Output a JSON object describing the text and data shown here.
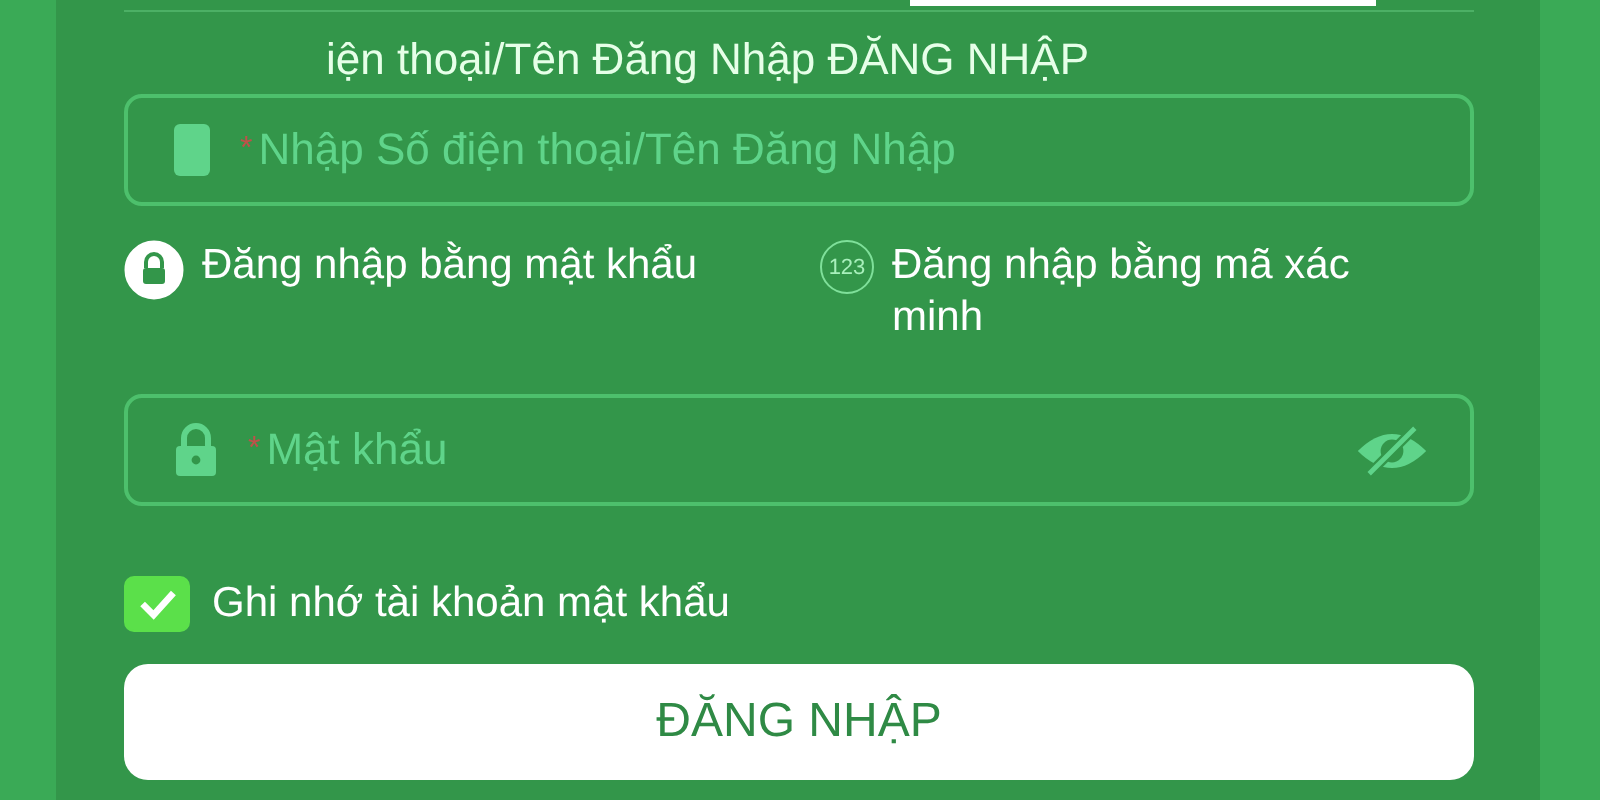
{
  "heading": "iện thoại/Tên Đăng Nhập ĐĂNG NHẬP",
  "required_mark": "*",
  "username": {
    "placeholder": "Nhập Số điện thoại/Tên Đăng Nhập",
    "required": true
  },
  "login_modes": [
    {
      "kind": "password",
      "label": "Đăng nhập bằng mật khẩu",
      "selected": true
    },
    {
      "kind": "code",
      "icon_text": "123",
      "label": "Đăng nhập bằng mã xác minh",
      "selected": false
    }
  ],
  "password": {
    "placeholder": "Mật khẩu",
    "required": true
  },
  "remember": {
    "label": "Ghi nhớ tài khoản mật khẩu",
    "checked": true
  },
  "submit": "ĐĂNG NHẬP"
}
